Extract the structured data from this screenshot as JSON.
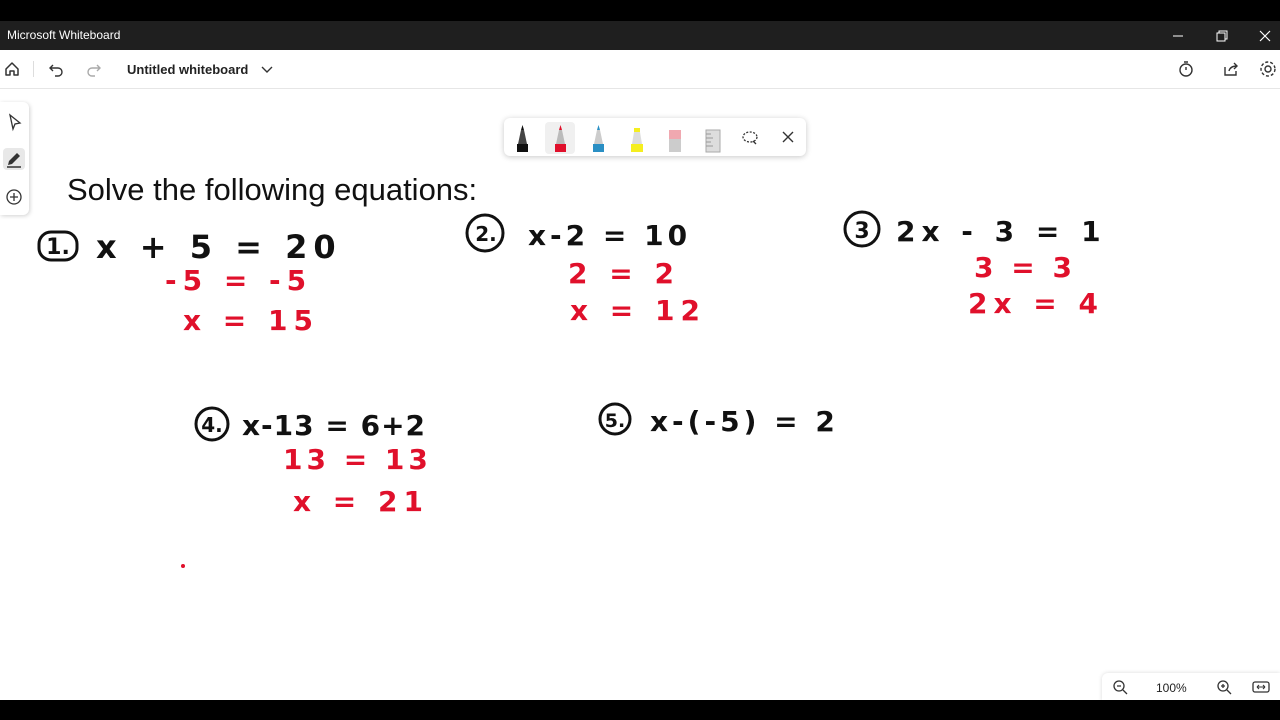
{
  "window": {
    "title": "Microsoft Whiteboard"
  },
  "appbar": {
    "doc_title": "Untitled whiteboard"
  },
  "canvas": {
    "heading": "Solve the following equations:"
  },
  "problems": [
    {
      "number": "1.",
      "equation": "x + 5 = 20",
      "steps": [
        "-5 = -5",
        "x = 15"
      ]
    },
    {
      "number": "2.",
      "equation": "x-2 = 10",
      "steps": [
        "2 = 2",
        "x = 12"
      ]
    },
    {
      "number": "3",
      "equation": "2x - 3 = 1",
      "steps": [
        "3 = 3",
        "2x = 4"
      ]
    },
    {
      "number": "4.",
      "equation": "x-13 = 6+2",
      "steps": [
        "13 = 13",
        "x = 21"
      ]
    },
    {
      "number": "5.",
      "equation": "x-(-5) = 2",
      "steps": []
    }
  ],
  "zoom": {
    "level": "100%"
  },
  "colors": {
    "ink_black": "#111111",
    "ink_red": "#e0102b",
    "titlebar": "#1f1f1f"
  },
  "icons": [
    "home-icon",
    "undo-icon",
    "redo-icon",
    "chevron-down-icon",
    "timer-icon",
    "share-icon",
    "settings-icon",
    "select-icon",
    "pen-icon",
    "add-icon",
    "lasso-icon",
    "close-icon",
    "zoom-out-icon",
    "zoom-in-icon",
    "fit-icon"
  ]
}
